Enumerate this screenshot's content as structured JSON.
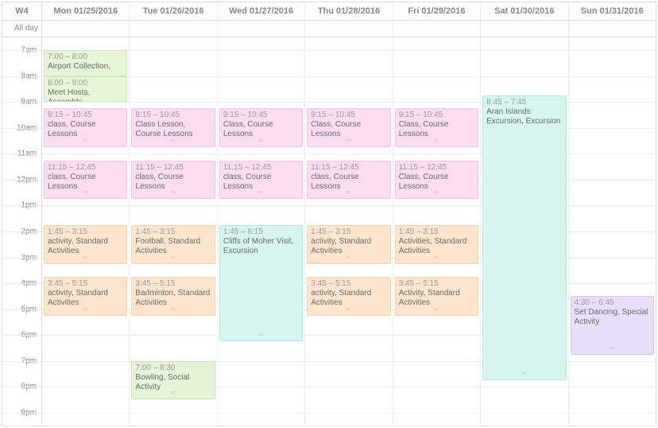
{
  "calendar": {
    "week_label": "W4",
    "allday_label": "All day",
    "day_start_hour": 6.5,
    "day_end_hour": 21.5,
    "hours": [
      "7am",
      "8am",
      "9am",
      "10am",
      "11am",
      "12pm",
      "1pm",
      "2pm",
      "3pm",
      "4pm",
      "5pm",
      "6pm",
      "7pm",
      "8pm",
      "9pm"
    ],
    "hour_values": [
      7,
      8,
      9,
      10,
      11,
      12,
      13,
      14,
      15,
      16,
      17,
      18,
      19,
      20,
      21
    ],
    "days": [
      {
        "label": "Mon 01/25/2016"
      },
      {
        "label": "Tue 01/26/2016"
      },
      {
        "label": "Wed 01/27/2016"
      },
      {
        "label": "Thu 01/28/2016"
      },
      {
        "label": "Fri 01/29/2016"
      },
      {
        "label": "Sat 01/30/2016"
      },
      {
        "label": "Sun 01/31/2016"
      }
    ],
    "categories": {
      "lesson": "cat-lesson",
      "host": "cat-host",
      "activity": "cat-activity",
      "excursion": "cat-excursion",
      "social": "cat-social",
      "special": "cat-special"
    },
    "events": [
      {
        "day": 0,
        "start": 7.0,
        "end": 8.0,
        "time_label": "7:00 – 8:00",
        "title": "Airport Collection,",
        "category": "host"
      },
      {
        "day": 0,
        "start": 8.0,
        "end": 9.0,
        "time_label": "8:00 – 9:00",
        "title": "Meet Hosts, Assembly",
        "category": "host"
      },
      {
        "day": 0,
        "start": 9.25,
        "end": 10.75,
        "time_label": "9:15 – 10:45",
        "title": "class, Course Lessons",
        "category": "lesson"
      },
      {
        "day": 1,
        "start": 9.25,
        "end": 10.75,
        "time_label": "9:15 – 10:45",
        "title": "Class Lesson, Course Lessons",
        "category": "lesson"
      },
      {
        "day": 2,
        "start": 9.25,
        "end": 10.75,
        "time_label": "9:15 – 10:45",
        "title": "Class, Course Lessons",
        "category": "lesson"
      },
      {
        "day": 3,
        "start": 9.25,
        "end": 10.75,
        "time_label": "9:15 – 10:45",
        "title": "Class, Course Lessons",
        "category": "lesson"
      },
      {
        "day": 4,
        "start": 9.25,
        "end": 10.75,
        "time_label": "9:15 – 10:45",
        "title": "Class, Course Lessons",
        "category": "lesson"
      },
      {
        "day": 0,
        "start": 11.25,
        "end": 12.75,
        "time_label": "11:15 – 12:45",
        "title": "class, Course Lessons",
        "category": "lesson"
      },
      {
        "day": 1,
        "start": 11.25,
        "end": 12.75,
        "time_label": "11:15 – 12:45",
        "title": "class, Course Lessons",
        "category": "lesson"
      },
      {
        "day": 2,
        "start": 11.25,
        "end": 12.75,
        "time_label": "11:15 – 12:45",
        "title": "class, Course Lessons",
        "category": "lesson"
      },
      {
        "day": 3,
        "start": 11.25,
        "end": 12.75,
        "time_label": "11:15 – 12:45",
        "title": "class, Course Lessons",
        "category": "lesson"
      },
      {
        "day": 4,
        "start": 11.25,
        "end": 12.75,
        "time_label": "11:15 – 12:45",
        "title": "Class, Course Lessons",
        "category": "lesson"
      },
      {
        "day": 0,
        "start": 13.75,
        "end": 15.25,
        "time_label": "1:45 – 3:15",
        "title": "activity, Standard Activities",
        "category": "activity"
      },
      {
        "day": 1,
        "start": 13.75,
        "end": 15.25,
        "time_label": "1:45 – 3:15",
        "title": "Football, Standard Activities",
        "category": "activity"
      },
      {
        "day": 2,
        "start": 13.75,
        "end": 18.25,
        "time_label": "1:45 – 6:15",
        "title": "Cliffs of Moher Visit, Excursion",
        "category": "excursion"
      },
      {
        "day": 3,
        "start": 13.75,
        "end": 15.25,
        "time_label": "1:45 – 3:15",
        "title": "activity, Standard Activities",
        "category": "activity"
      },
      {
        "day": 4,
        "start": 13.75,
        "end": 15.25,
        "time_label": "1:45 – 3:15",
        "title": "Activities, Standard Activities",
        "category": "activity"
      },
      {
        "day": 0,
        "start": 15.75,
        "end": 17.25,
        "time_label": "3:45 – 5:15",
        "title": "activity, Standard Activities",
        "category": "activity"
      },
      {
        "day": 1,
        "start": 15.75,
        "end": 17.25,
        "time_label": "3:45 – 5:15",
        "title": "Badminton, Standard Activities",
        "category": "activity"
      },
      {
        "day": 3,
        "start": 15.75,
        "end": 17.25,
        "time_label": "3:45 – 5:15",
        "title": "activity, Standard Activities",
        "category": "activity"
      },
      {
        "day": 4,
        "start": 15.75,
        "end": 17.25,
        "time_label": "3:45 – 5:15",
        "title": "Activity, Standard Activities",
        "category": "activity"
      },
      {
        "day": 1,
        "start": 19.0,
        "end": 20.5,
        "time_label": "7:00 – 8:30",
        "title": "Bowling, Social Activity",
        "category": "social"
      },
      {
        "day": 5,
        "start": 8.75,
        "end": 19.75,
        "time_label": "8:45 – 7:45",
        "title": "Aran Islands Excursion, Excursion",
        "category": "excursion"
      },
      {
        "day": 6,
        "start": 16.5,
        "end": 18.75,
        "time_label": "4:30 – 6:45",
        "title": "Set Dancing, Special Activity",
        "category": "special"
      }
    ]
  }
}
